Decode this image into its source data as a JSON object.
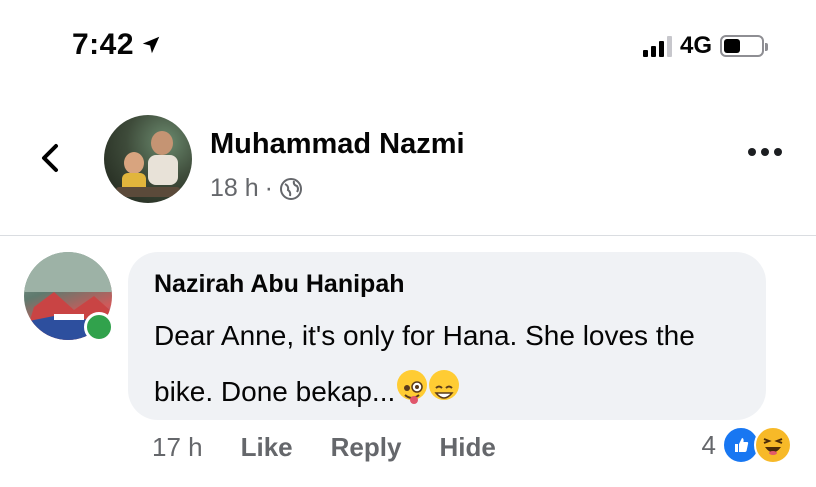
{
  "status_bar": {
    "time": "7:42",
    "network": "4G",
    "signal_bars_active": 3,
    "signal_bars_total": 4,
    "battery_level": 0.45,
    "icons": [
      "location-arrow-icon",
      "signal-icon",
      "battery-icon"
    ]
  },
  "post": {
    "author": "Muhammad Nazmi",
    "time": "18 h",
    "separator": "·",
    "privacy_icon": "globe-icon",
    "back_icon": "chevron-left-icon",
    "more_icon": "more-horizontal-icon"
  },
  "comment": {
    "author": "Nazirah Abu Hanipah",
    "text": "Dear Anne, it's only for Hana. She loves the bike. Done bekap...",
    "emojis": [
      "winking-face-with-tongue",
      "grinning-face-with-smiling-eyes"
    ],
    "time": "17 h",
    "actions": {
      "like": "Like",
      "reply": "Reply",
      "hide": "Hide"
    },
    "reaction_count": "4",
    "reaction_icons": [
      "like-reaction-icon",
      "haha-reaction-icon"
    ],
    "online": true
  },
  "colors": {
    "accent_blue": "#1877f2",
    "online_green": "#31a24c",
    "bubble_bg": "#f0f2f5",
    "secondary_text": "#65676b"
  }
}
